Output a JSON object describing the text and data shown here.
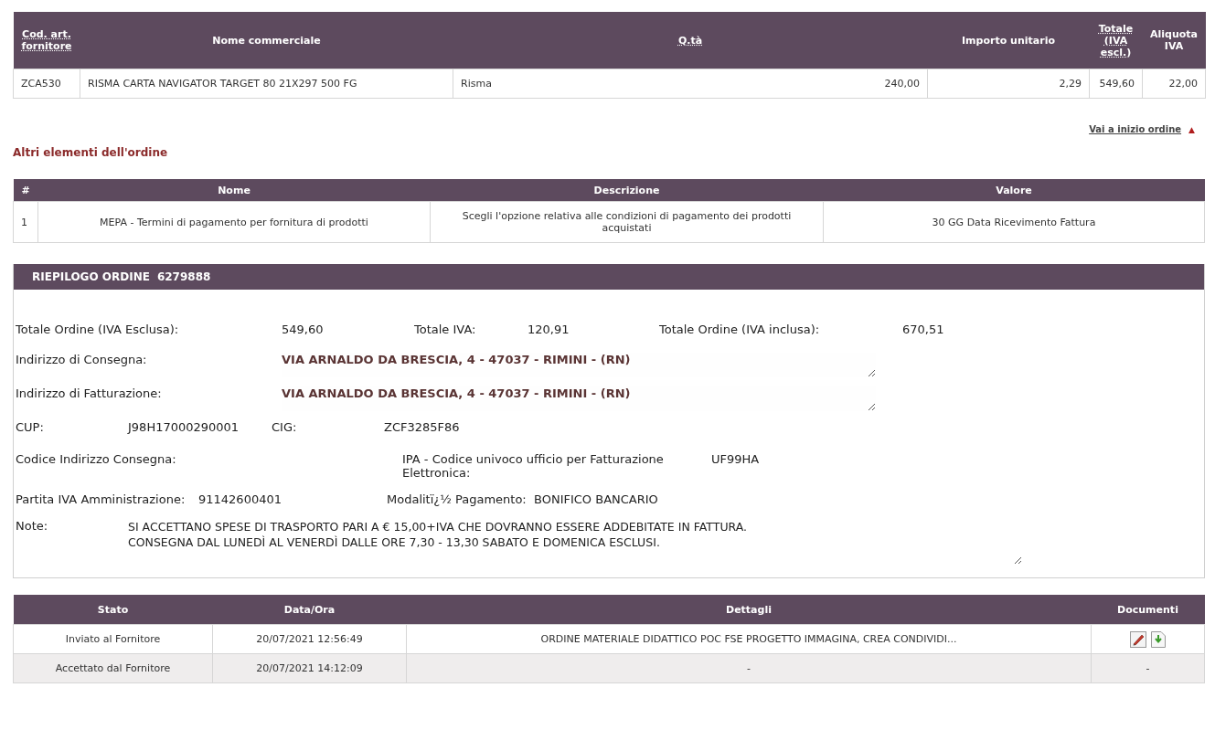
{
  "items_table": {
    "columns": [
      {
        "label": "Cod. art. fornitore",
        "abbr": true
      },
      {
        "label": "Nome commerciale",
        "abbr": false
      },
      {
        "label": "Q.tà",
        "abbr": true
      },
      {
        "label": "Importo unitario",
        "abbr": false
      },
      {
        "label": "Totale (IVA escl.)",
        "abbr": true
      },
      {
        "label": "Aliquota IVA",
        "abbr": false
      }
    ],
    "rows": [
      {
        "code": "ZCA530",
        "name": "RISMA CARTA NAVIGATOR TARGET 80 21X297 500 FG",
        "unit": "Risma",
        "quantity": "240,00",
        "unit_price": "2,29",
        "total": "549,60",
        "vat_rate": "22,00"
      }
    ]
  },
  "back_to_top": {
    "label": "Vai a inizio ordine",
    "arrow": "▲"
  },
  "other_elements": {
    "title": "Altri elementi dell'ordine",
    "columns": [
      "#",
      "Nome",
      "Descrizione",
      "Valore"
    ],
    "rows": [
      {
        "number": "1",
        "name": "MEPA - Termini di pagamento per fornitura di prodotti",
        "description": "Scegli l'opzione relativa alle condizioni di pagamento dei prodotti acquistati",
        "value": "30 GG Data Ricevimento Fattura"
      }
    ]
  },
  "summary": {
    "title": "RIEPILOGO ORDINE",
    "order_number": "6279888",
    "total_excl_label": "Totale Ordine (IVA Esclusa):",
    "total_excl": "549,60",
    "vat_label": "Totale IVA:",
    "vat": "120,91",
    "total_incl_label": "Totale Ordine (IVA inclusa):",
    "total_incl": "670,51",
    "delivery_address_label": "Indirizzo di Consegna:",
    "delivery_address": "VIA ARNALDO DA BRESCIA, 4 - 47037 - RIMINI - (RN)",
    "billing_address_label": "Indirizzo di Fatturazione:",
    "billing_address": "VIA ARNALDO DA BRESCIA, 4 - 47037 - RIMINI - (RN)",
    "cup_label": "CUP:",
    "cup": "J98H17000290001",
    "cig_label": "CIG:",
    "cig": "ZCF3285F86",
    "delivery_code_label": "Codice Indirizzo Consegna:",
    "ipa_label": "IPA - Codice univoco ufficio per Fatturazione Elettronica:",
    "ipa": "UF99HA",
    "vat_number_label": "Partita IVA Amministrazione:",
    "vat_number": "91142600401",
    "payment_label": "Modalitï¿½ Pagamento:",
    "payment": "BONIFICO BANCARIO",
    "notes_label": "Note:",
    "notes": [
      "SI ACCETTANO SPESE DI TRASPORTO PARI A € 15,00+IVA CHE DOVRANNO ESSERE ADDEBITATE IN FATTURA.",
      "CONSEGNA DAL LUNEDÌ AL VENERDÌ DALLE ORE 7,30 - 13,30 SABATO E DOMENICA ESCLUSI."
    ]
  },
  "history": {
    "columns": [
      "Stato",
      "Data/Ora",
      "Dettagli",
      "Documenti"
    ],
    "rows": [
      {
        "status": "Inviato al Fornitore",
        "datetime": "20/07/2021 12:56:49",
        "details": "ORDINE MATERIALE DIDATTICO POC FSE PROGETTO IMMAGINA, CREA CONDIVIDI...",
        "kind": "icons"
      },
      {
        "status": "Accettato dal Fornitore",
        "datetime": "20/07/2021 14:12:09",
        "details": "-",
        "kind": "text",
        "documents": "-"
      }
    ]
  }
}
